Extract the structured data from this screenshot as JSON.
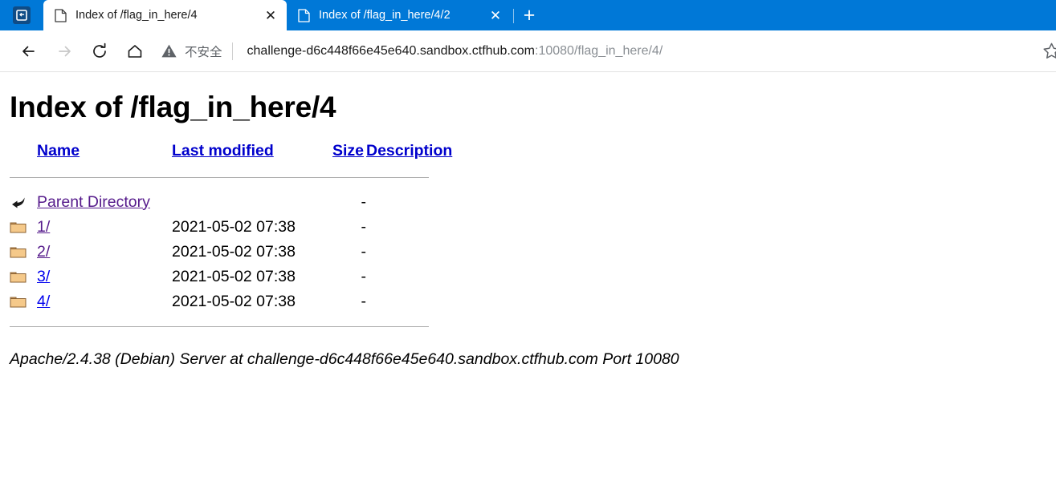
{
  "browser": {
    "app_icon_name": "tab-actions-icon",
    "tabs": [
      {
        "title": "Index of /flag_in_here/4",
        "active": true,
        "favicon": "page-icon",
        "close_label": "✕"
      },
      {
        "title": "Index of /flag_in_here/4/2",
        "active": false,
        "favicon": "page-icon",
        "close_label": "✕"
      }
    ],
    "new_tab_label": "+",
    "toolbar": {
      "back_label": "←",
      "forward_label": "→",
      "reload_label": "↻",
      "home_label": "⌂",
      "security_text": "不安全",
      "url_domain": "challenge-d6c448f66e45e640.sandbox.ctfhub.com",
      "url_path": ":10080/flag_in_here/4/",
      "favorite_label": "☆"
    }
  },
  "page": {
    "title": "Index of /flag_in_here/4",
    "headers": {
      "name": "Name",
      "last_modified": "Last modified",
      "size": "Size",
      "description": "Description"
    },
    "rows": [
      {
        "icon": "back-arrow-icon",
        "name": "Parent Directory",
        "last_modified": "",
        "size": "-",
        "description": "",
        "visited": true
      },
      {
        "icon": "folder-icon",
        "name": "1/",
        "last_modified": "2021-05-02 07:38",
        "size": "-",
        "description": "",
        "visited": true
      },
      {
        "icon": "folder-icon",
        "name": "2/",
        "last_modified": "2021-05-02 07:38",
        "size": "-",
        "description": "",
        "visited": true
      },
      {
        "icon": "folder-icon",
        "name": "3/",
        "last_modified": "2021-05-02 07:38",
        "size": "-",
        "description": "",
        "visited": false
      },
      {
        "icon": "folder-icon",
        "name": "4/",
        "last_modified": "2021-05-02 07:38",
        "size": "-",
        "description": "",
        "visited": false
      }
    ],
    "footer": "Apache/2.4.38 (Debian) Server at challenge-d6c448f66e45e640.sandbox.ctfhub.com Port 10080"
  },
  "colors": {
    "tabstrip_blue": "#0078d7",
    "link_unvisited": "#0000ee",
    "link_visited": "#551a8b",
    "header_link": "#0000cc",
    "folder_fill": "#f5c98a"
  }
}
